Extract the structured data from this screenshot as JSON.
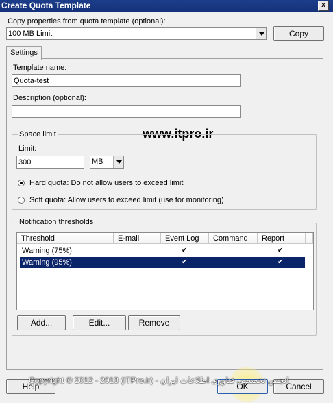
{
  "window": {
    "title": "Create Quota Template",
    "close_glyph": "x"
  },
  "copy_from": {
    "label": "Copy properties from quota template (optional):",
    "selected": "100 MB Limit",
    "copy_button": "Copy"
  },
  "tabs": [
    {
      "label": "Settings"
    }
  ],
  "settings": {
    "template_name_label": "Template name:",
    "template_name_value": "Quota-test",
    "description_label": "Description (optional):",
    "description_value": ""
  },
  "space_limit": {
    "legend": "Space limit",
    "limit_label": "Limit:",
    "limit_value": "300",
    "unit": "MB",
    "hard_quota_label": "Hard quota: Do not allow users to exceed limit",
    "soft_quota_label": "Soft quota: Allow users to exceed limit (use for monitoring)",
    "selected": "hard"
  },
  "watermark": "www.itpro.ir",
  "notifications": {
    "legend": "Notification thresholds",
    "columns": [
      "Threshold",
      "E-mail",
      "Event Log",
      "Command",
      "Report"
    ],
    "rows": [
      {
        "threshold": "Warning (75%)",
        "email": false,
        "event_log": true,
        "command": false,
        "report": true,
        "selected": false
      },
      {
        "threshold": "Warning (95%)",
        "email": false,
        "event_log": true,
        "command": false,
        "report": true,
        "selected": true
      }
    ],
    "check_glyph": "✔",
    "buttons": {
      "add": "Add...",
      "edit": "Edit...",
      "remove": "Remove"
    }
  },
  "footer": {
    "help": "Help",
    "copyright": "Copyright © 2012 - 2013 (ITPro.ir) - انجمن تخصصی فناوری اطلاعات ایران",
    "ok": "OK",
    "cancel": "Cancel"
  },
  "colors": {
    "title_bar": "#15317a",
    "selection": "#0a246a"
  }
}
